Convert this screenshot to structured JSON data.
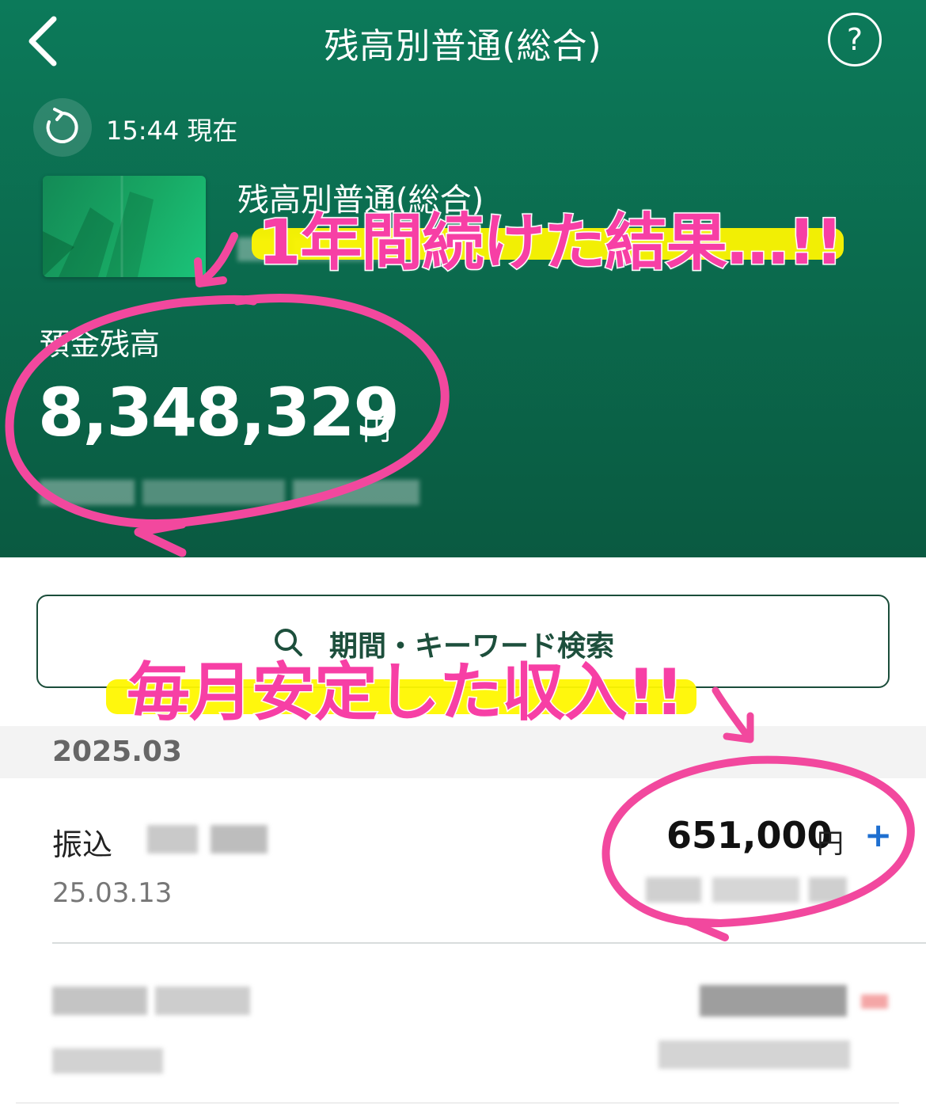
{
  "nav": {
    "title": "残高別普通(総合)",
    "help_label": "?"
  },
  "status": {
    "time_text": "15:44 現在"
  },
  "account": {
    "name": "残高別普通(総合)"
  },
  "balance": {
    "label": "預金残高",
    "amount": "8,348,329",
    "unit": "円"
  },
  "search": {
    "label": "期間・キーワード検索"
  },
  "transactions": {
    "month": "2025.03",
    "items": [
      {
        "type": "振込",
        "date": "25.03.13",
        "amount": "651,000",
        "unit": "円",
        "direction": "+"
      }
    ]
  },
  "annotations": {
    "headline": "1年間続けた結果…!!",
    "income_note": "毎月安定した収入!!"
  },
  "colors": {
    "header_green": "#0b6a4d",
    "annotation_pink": "#f73fa5",
    "highlight_yellow": "#fff700",
    "plus_blue": "#1e6fd0"
  }
}
